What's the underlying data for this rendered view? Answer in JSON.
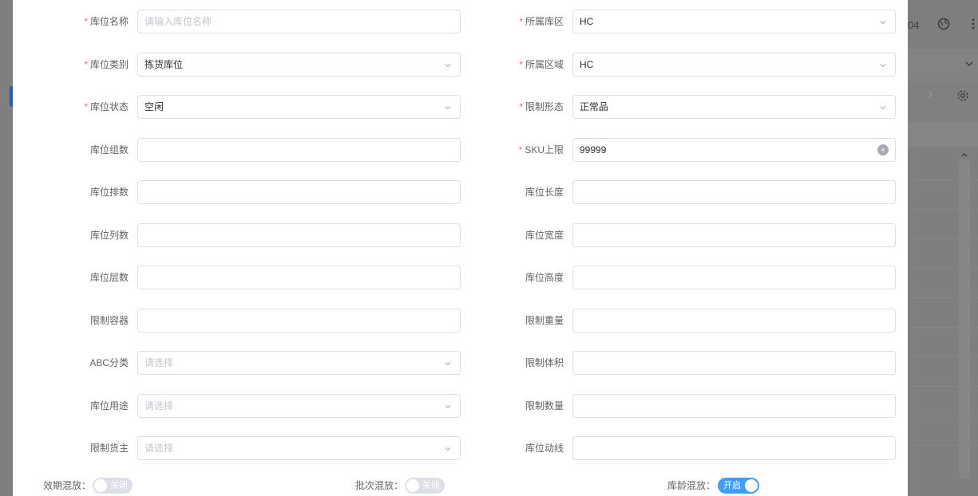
{
  "background": {
    "top_text": "04",
    "icons": [
      "globe-icon",
      "more-vertical-icon",
      "chevron-down-icon",
      "chevron-right-icon",
      "gear-icon",
      "chevron-up-icon"
    ]
  },
  "form": {
    "left": [
      {
        "label": "库位名称",
        "required": true,
        "type": "input",
        "value": "",
        "placeholder": "请输入库位名称"
      },
      {
        "label": "库位类别",
        "required": true,
        "type": "select",
        "value": "拣货库位",
        "placeholder": ""
      },
      {
        "label": "库位状态",
        "required": true,
        "type": "select",
        "value": "空闲",
        "placeholder": ""
      },
      {
        "label": "库位组数",
        "required": false,
        "type": "input",
        "value": "",
        "placeholder": ""
      },
      {
        "label": "库位排数",
        "required": false,
        "type": "input",
        "value": "",
        "placeholder": ""
      },
      {
        "label": "库位列数",
        "required": false,
        "type": "input",
        "value": "",
        "placeholder": ""
      },
      {
        "label": "库位层数",
        "required": false,
        "type": "input",
        "value": "",
        "placeholder": ""
      },
      {
        "label": "限制容器",
        "required": false,
        "type": "input",
        "value": "",
        "placeholder": ""
      },
      {
        "label": "ABC分类",
        "required": false,
        "type": "select",
        "value": "",
        "placeholder": "请选择"
      },
      {
        "label": "库位用途",
        "required": false,
        "type": "select",
        "value": "",
        "placeholder": "请选择"
      },
      {
        "label": "限制货主",
        "required": false,
        "type": "select",
        "value": "",
        "placeholder": "请选择"
      }
    ],
    "right": [
      {
        "label": "所属库区",
        "required": true,
        "type": "select",
        "value": "HC",
        "placeholder": ""
      },
      {
        "label": "所属区域",
        "required": true,
        "type": "select",
        "value": "HC",
        "placeholder": ""
      },
      {
        "label": "限制形态",
        "required": true,
        "type": "select",
        "value": "正常品",
        "placeholder": ""
      },
      {
        "label": "SKU上限",
        "required": true,
        "type": "clearable",
        "value": "99999",
        "placeholder": ""
      },
      {
        "label": "库位长度",
        "required": false,
        "type": "input",
        "value": "",
        "placeholder": ""
      },
      {
        "label": "库位宽度",
        "required": false,
        "type": "input",
        "value": "",
        "placeholder": ""
      },
      {
        "label": "库位高度",
        "required": false,
        "type": "input",
        "value": "",
        "placeholder": ""
      },
      {
        "label": "限制重量",
        "required": false,
        "type": "input",
        "value": "",
        "placeholder": ""
      },
      {
        "label": "限制体积",
        "required": false,
        "type": "input",
        "value": "",
        "placeholder": ""
      },
      {
        "label": "限制数量",
        "required": false,
        "type": "input",
        "value": "",
        "placeholder": ""
      },
      {
        "label": "库位动线",
        "required": false,
        "type": "input",
        "value": "",
        "placeholder": ""
      }
    ]
  },
  "switches": [
    {
      "label": "效期混放：",
      "state_text": "关闭",
      "on": false
    },
    {
      "label": "批次混放：",
      "state_text": "关闭",
      "on": false
    },
    {
      "label": "库龄混放：",
      "state_text": "开启",
      "on": true
    }
  ],
  "colors": {
    "required": "#f56c6c",
    "switch_on": "#409eff",
    "switch_off": "#dcdfe6",
    "border": "#dcdfe6"
  }
}
